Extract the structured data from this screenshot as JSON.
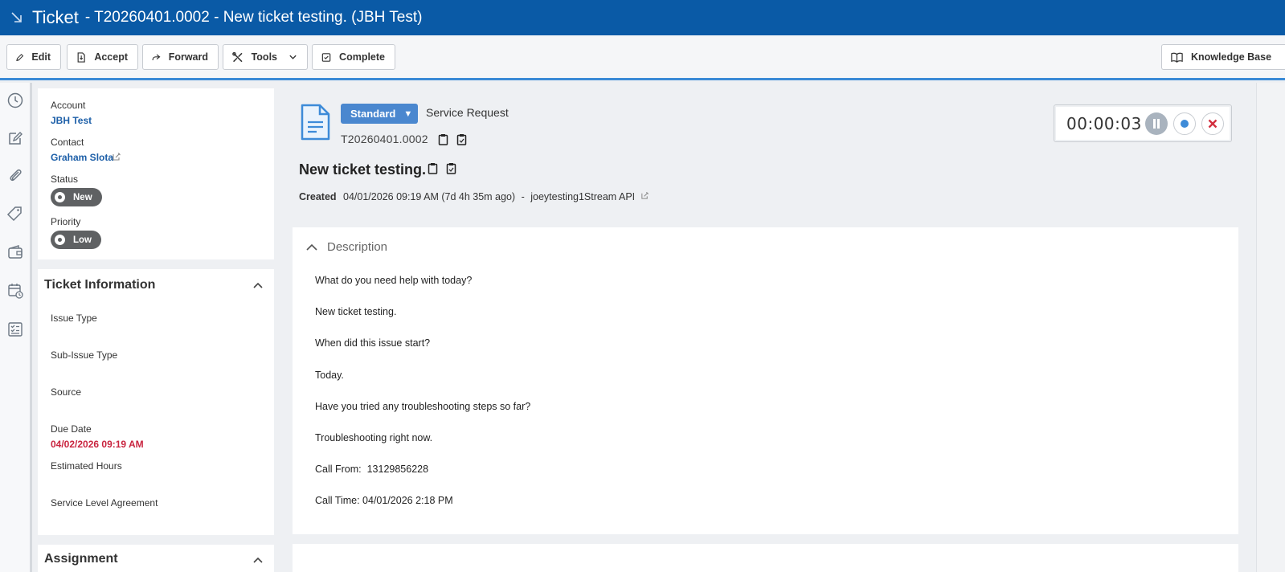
{
  "title": {
    "main": "Ticket",
    "sub": "- T20260401.0002 - New ticket testing. (JBH Test)"
  },
  "toolbar": {
    "edit": "Edit",
    "accept": "Accept",
    "forward": "Forward",
    "tools": "Tools",
    "complete": "Complete",
    "knowledge_base": "Knowledge Base"
  },
  "account_panel": {
    "account_label": "Account",
    "account_value": "JBH Test",
    "contact_label": "Contact",
    "contact_value": "Graham Slota",
    "status_label": "Status",
    "status_value": "New",
    "priority_label": "Priority",
    "priority_value": "Low"
  },
  "ticket_info": {
    "title": "Ticket Information",
    "issue_type": "Issue Type",
    "sub_issue_type": "Sub-Issue Type",
    "source": "Source",
    "due_date_label": "Due Date",
    "due_date_value": "04/02/2026 09:19 AM",
    "estimated_hours": "Estimated Hours",
    "sla": "Service Level Agreement"
  },
  "assignment": {
    "title": "Assignment"
  },
  "ticket": {
    "category": "Standard",
    "type": "Service Request",
    "number": "T20260401.0002",
    "title": "New ticket testing.",
    "created_label": "Created",
    "created_value": "04/01/2026 09:19 AM (7d 4h 35m ago)",
    "created_sep": "-",
    "created_by": "joeytesting1Stream API"
  },
  "timer": {
    "time": "00:00:03"
  },
  "description": {
    "title": "Description",
    "lines": [
      "What do you need help with today?",
      "New ticket testing.",
      "When did this issue start?",
      "Today.",
      "Have you tried any troubleshooting steps so far?",
      "Troubleshooting right now.",
      "Call From:  13129856228",
      "Call Time: 04/01/2026 2:18 PM"
    ]
  },
  "colors": {
    "titlebar": "#0a5aa6",
    "accent": "#4a87cf",
    "due_date": "#c9243f",
    "link": "#1d5fa8"
  }
}
